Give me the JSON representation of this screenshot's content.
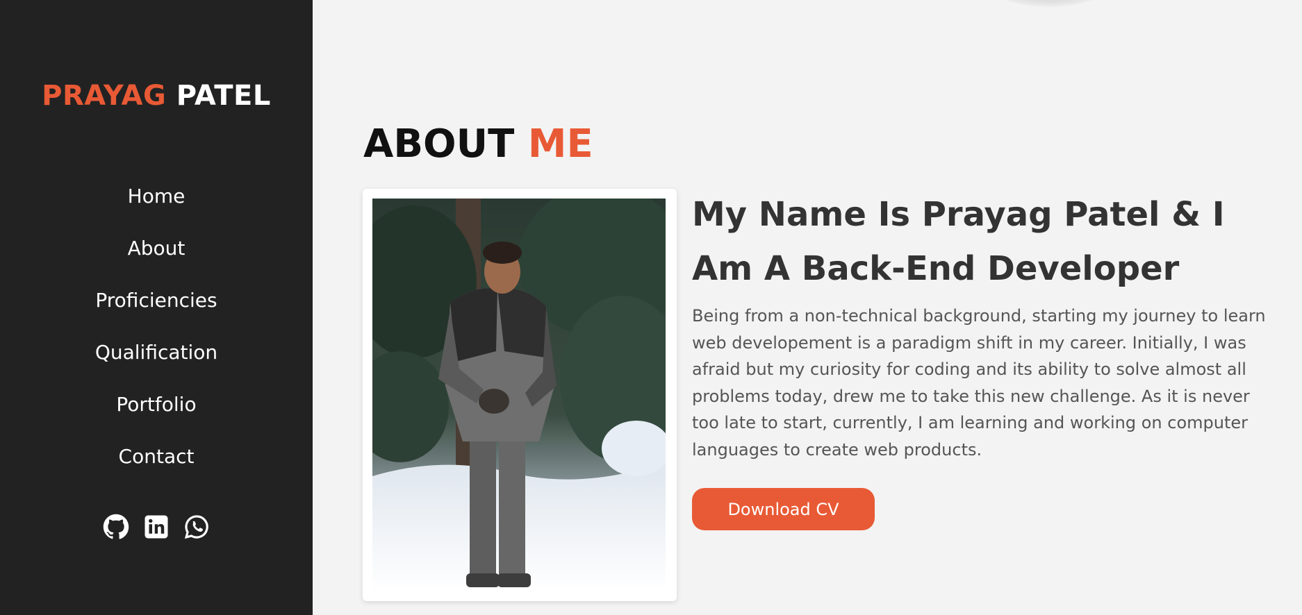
{
  "sidebar": {
    "brand": {
      "first": "PRAYAG",
      "last": "PATEL"
    },
    "nav": [
      "Home",
      "About",
      "Proficiencies",
      "Qualification",
      "Portfolio",
      "Contact"
    ],
    "socials": [
      "github-icon",
      "linkedin-icon",
      "whatsapp-icon"
    ]
  },
  "about": {
    "title_main": "ABOUT ",
    "title_accent": "ME",
    "heading": "My Name Is Prayag Patel & I Am A Back-End Developer",
    "bio": "Being from a non-technical background, starting my journey to learn web developement is a paradigm shift in my career. Initially, I was afraid but my curiosity for coding and its ability to solve almost all problems today, drew me to take this new challenge. As it is never too late to start, currently, I am learning and working on computer languages to create web products.",
    "cv_button": "Download CV"
  },
  "colors": {
    "accent": "#e85a35",
    "sidebar_bg": "#222222",
    "page_bg": "#f3f3f3"
  }
}
